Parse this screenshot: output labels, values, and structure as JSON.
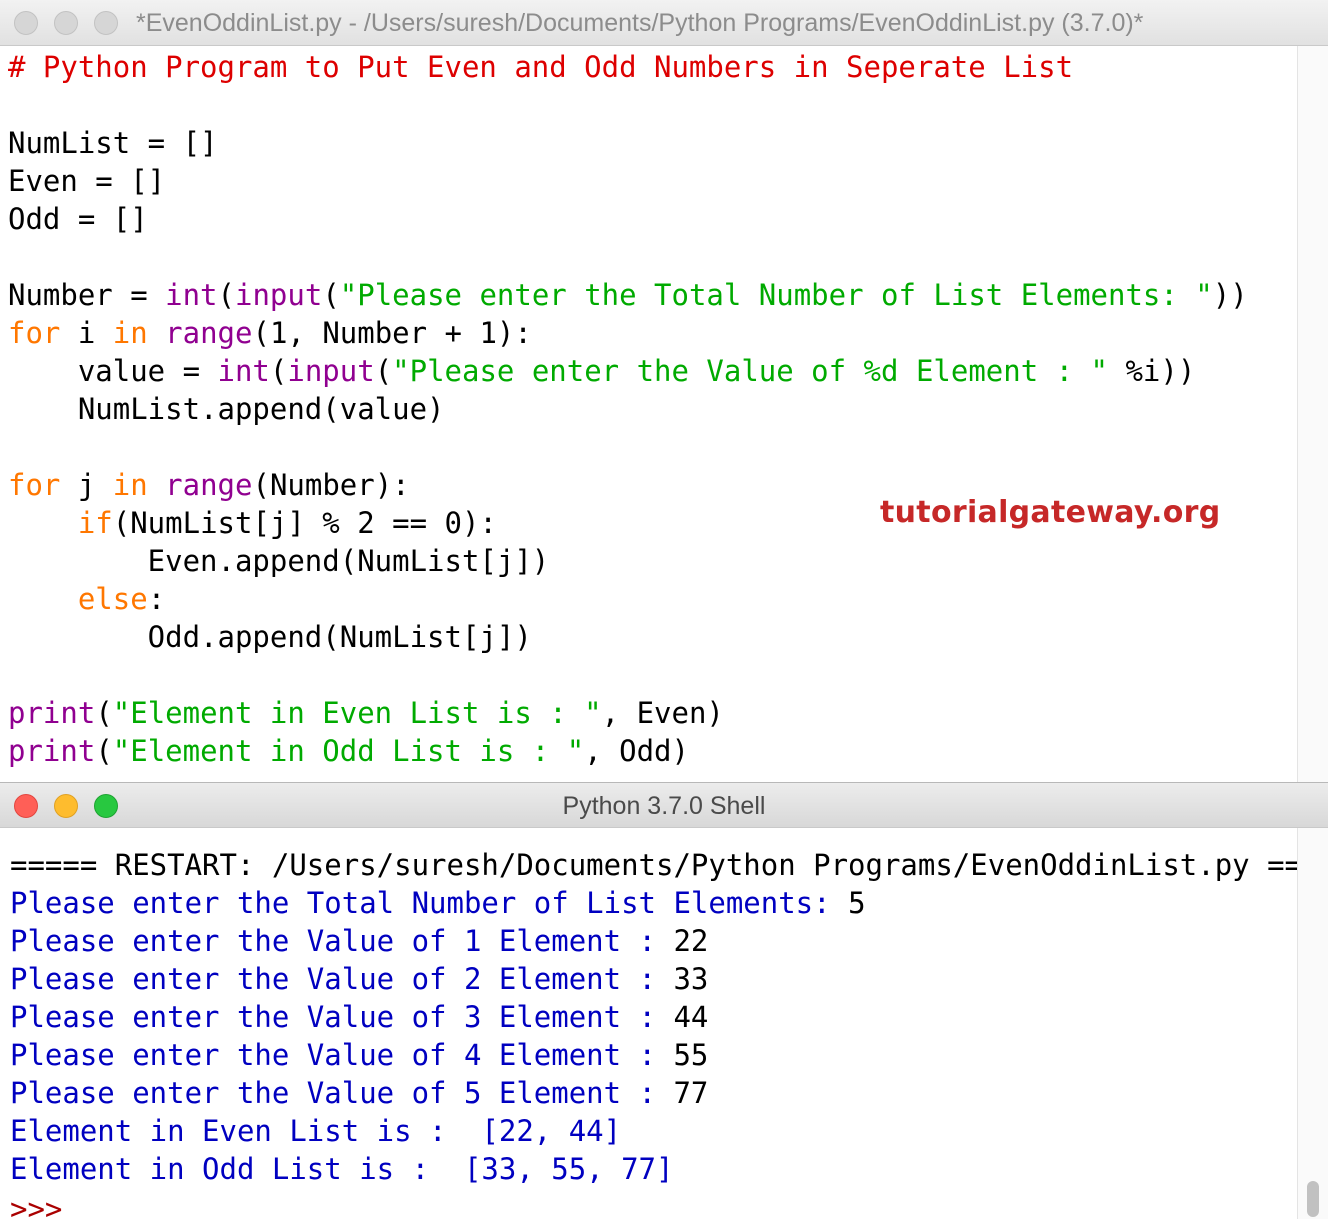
{
  "editor_window": {
    "title": "*EvenOddinList.py - /Users/suresh/Documents/Python Programs/EvenOddinList.py (3.7.0)*"
  },
  "editor_code": {
    "l01_comment": "# Python Program to Put Even and Odd Numbers in Seperate List",
    "l02_numlist": "NumList = []",
    "l03_even": "Even = []",
    "l04_odd": "Odd = []",
    "l05_a": "Number = ",
    "l05_int": "int",
    "l05_b": "(",
    "l05_input": "input",
    "l05_c": "(",
    "l05_str": "\"Please enter the Total Number of List Elements: \"",
    "l05_d": "))",
    "l06_for": "for",
    "l06_a": " i ",
    "l06_in": "in",
    "l06_b": " ",
    "l06_range": "range",
    "l06_c": "(1, Number + 1):",
    "l07_a": "    value = ",
    "l07_int": "int",
    "l07_b": "(",
    "l07_input": "input",
    "l07_c": "(",
    "l07_str": "\"Please enter the Value of %d Element : \"",
    "l07_d": " %i))",
    "l08": "    NumList.append(value)",
    "l09_for": "for",
    "l09_a": " j ",
    "l09_in": "in",
    "l09_b": " ",
    "l09_range": "range",
    "l09_c": "(Number):",
    "l10_indent": "    ",
    "l10_if": "if",
    "l10_a": "(NumList[j] % 2 == 0):",
    "l11": "        Even.append(NumList[j])",
    "l12_indent": "    ",
    "l12_else": "else",
    "l12_a": ":",
    "l13": "        Odd.append(NumList[j])",
    "l14_print": "print",
    "l14_a": "(",
    "l14_str": "\"Element in Even List is : \"",
    "l14_b": ", Even)",
    "l15_print": "print",
    "l15_a": "(",
    "l15_str": "\"Element in Odd List is : \"",
    "l15_b": ", Odd)"
  },
  "watermark": "tutorialgateway.org",
  "shell_window": {
    "title": "Python 3.7.0 Shell"
  },
  "shell_output": {
    "restart": "===== RESTART: /Users/suresh/Documents/Python Programs/EvenOddinList.py =====",
    "p1": "Please enter the Total Number of List Elements: ",
    "v1": "5",
    "p2": "Please enter the Value of 1 Element : ",
    "v2": "22",
    "p3": "Please enter the Value of 2 Element : ",
    "v3": "33",
    "p4": "Please enter the Value of 3 Element : ",
    "v4": "44",
    "p5": "Please enter the Value of 4 Element : ",
    "v5": "55",
    "p6": "Please enter the Value of 5 Element : ",
    "v6": "77",
    "even_result": "Element in Even List is :  [22, 44]",
    "odd_result": "Element in Odd List is :  [33, 55, 77]",
    "prompt_partial": ">>>",
    "prompt": ">>>"
  },
  "colors": {
    "comment": "#dd0000",
    "keyword": "#ff7700",
    "builtin": "#900090",
    "string": "#00aa00",
    "shell_output": "#0000c0",
    "watermark": "#c62828"
  }
}
